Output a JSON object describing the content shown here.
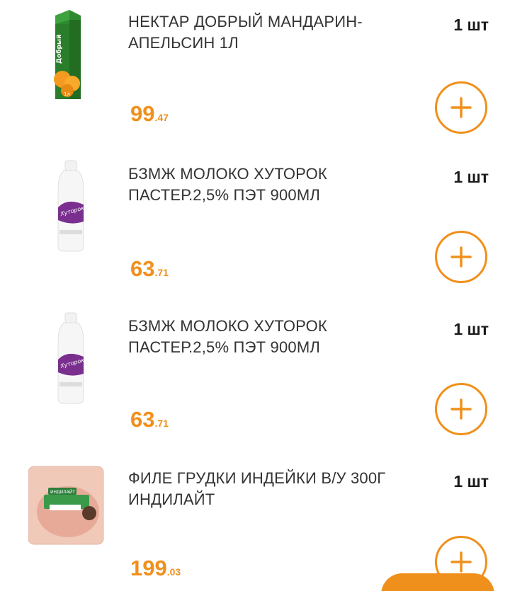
{
  "items": [
    {
      "name": "НЕКТАР ДОБРЫЙ МАНДАРИН-АПЕЛЬСИН 1Л",
      "qty": "1 шт",
      "price_int": "99",
      "price_frac": ".47",
      "image": "juice-carton-dobry",
      "brand_text": "Добрый"
    },
    {
      "name": "БЗМЖ МОЛОКО ХУТОРОК ПАСТЕР.2,5% ПЭТ 900МЛ",
      "qty": "1 шт",
      "price_int": "63",
      "price_frac": ".71",
      "image": "milk-bottle-khutorok",
      "brand_text": "Хуторок"
    },
    {
      "name": "БЗМЖ МОЛОКО ХУТОРОК ПАСТЕР.2,5% ПЭТ 900МЛ",
      "qty": "1 шт",
      "price_int": "63",
      "price_frac": ".71",
      "image": "milk-bottle-khutorok",
      "brand_text": "Хуторок"
    },
    {
      "name": "ФИЛЕ ГРУДКИ ИНДЕЙКИ В/У 300Г ИНДИЛАЙТ",
      "qty": "1 шт",
      "price_int": "199",
      "price_frac": ".03",
      "image": "turkey-fillet-pack-indilight",
      "brand_text": "ИНДИЛАЙТ"
    }
  ],
  "icons": {
    "add": "plus-circle-icon"
  },
  "colors": {
    "accent": "#f0901c",
    "text": "#333333",
    "qty_text": "#1a1a1a",
    "background": "#ffffff"
  }
}
